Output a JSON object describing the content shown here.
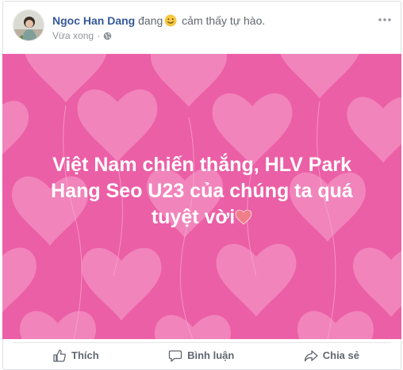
{
  "post": {
    "author": "Ngoc Han Dang",
    "feeling_prefix": "đang",
    "feeling_emoji": "smiling-face-icon",
    "feeling_text": "cảm thấy tự hào.",
    "timestamp": "Vừa xong",
    "separator": "·",
    "privacy_icon": "globe-icon",
    "more_icon": "more-options-icon"
  },
  "banner": {
    "text": "Việt Nam chiến thắng, HLV Park Hang Seo U23 của chúng ta quá tuyệt vời",
    "trailing_emoji": "heart-icon",
    "background_color": "#eb5fa6",
    "pattern": "balloon-hearts"
  },
  "actions": {
    "like": "Thích",
    "comment": "Bình luận",
    "share": "Chia sẻ"
  }
}
